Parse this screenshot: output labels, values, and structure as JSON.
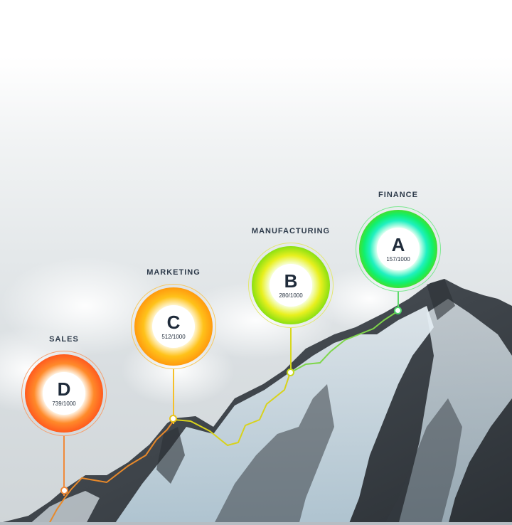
{
  "stages": [
    {
      "department": "SALES",
      "grade": "D",
      "score": "739/1000",
      "color": "#f47a20",
      "inner": "#ff5a1e"
    },
    {
      "department": "MARKETING",
      "grade": "C",
      "score": "512/1000",
      "color": "#f5b81a",
      "inner": "#ff9a0e"
    },
    {
      "department": "MANUFACTURING",
      "grade": "B",
      "score": "280/1000",
      "color": "#d6e020",
      "inner": "#c7ea12"
    },
    {
      "department": "FINANCE",
      "grade": "A",
      "score": "157/1000",
      "color": "#3ddc5a",
      "inner": "#10f070"
    }
  ]
}
